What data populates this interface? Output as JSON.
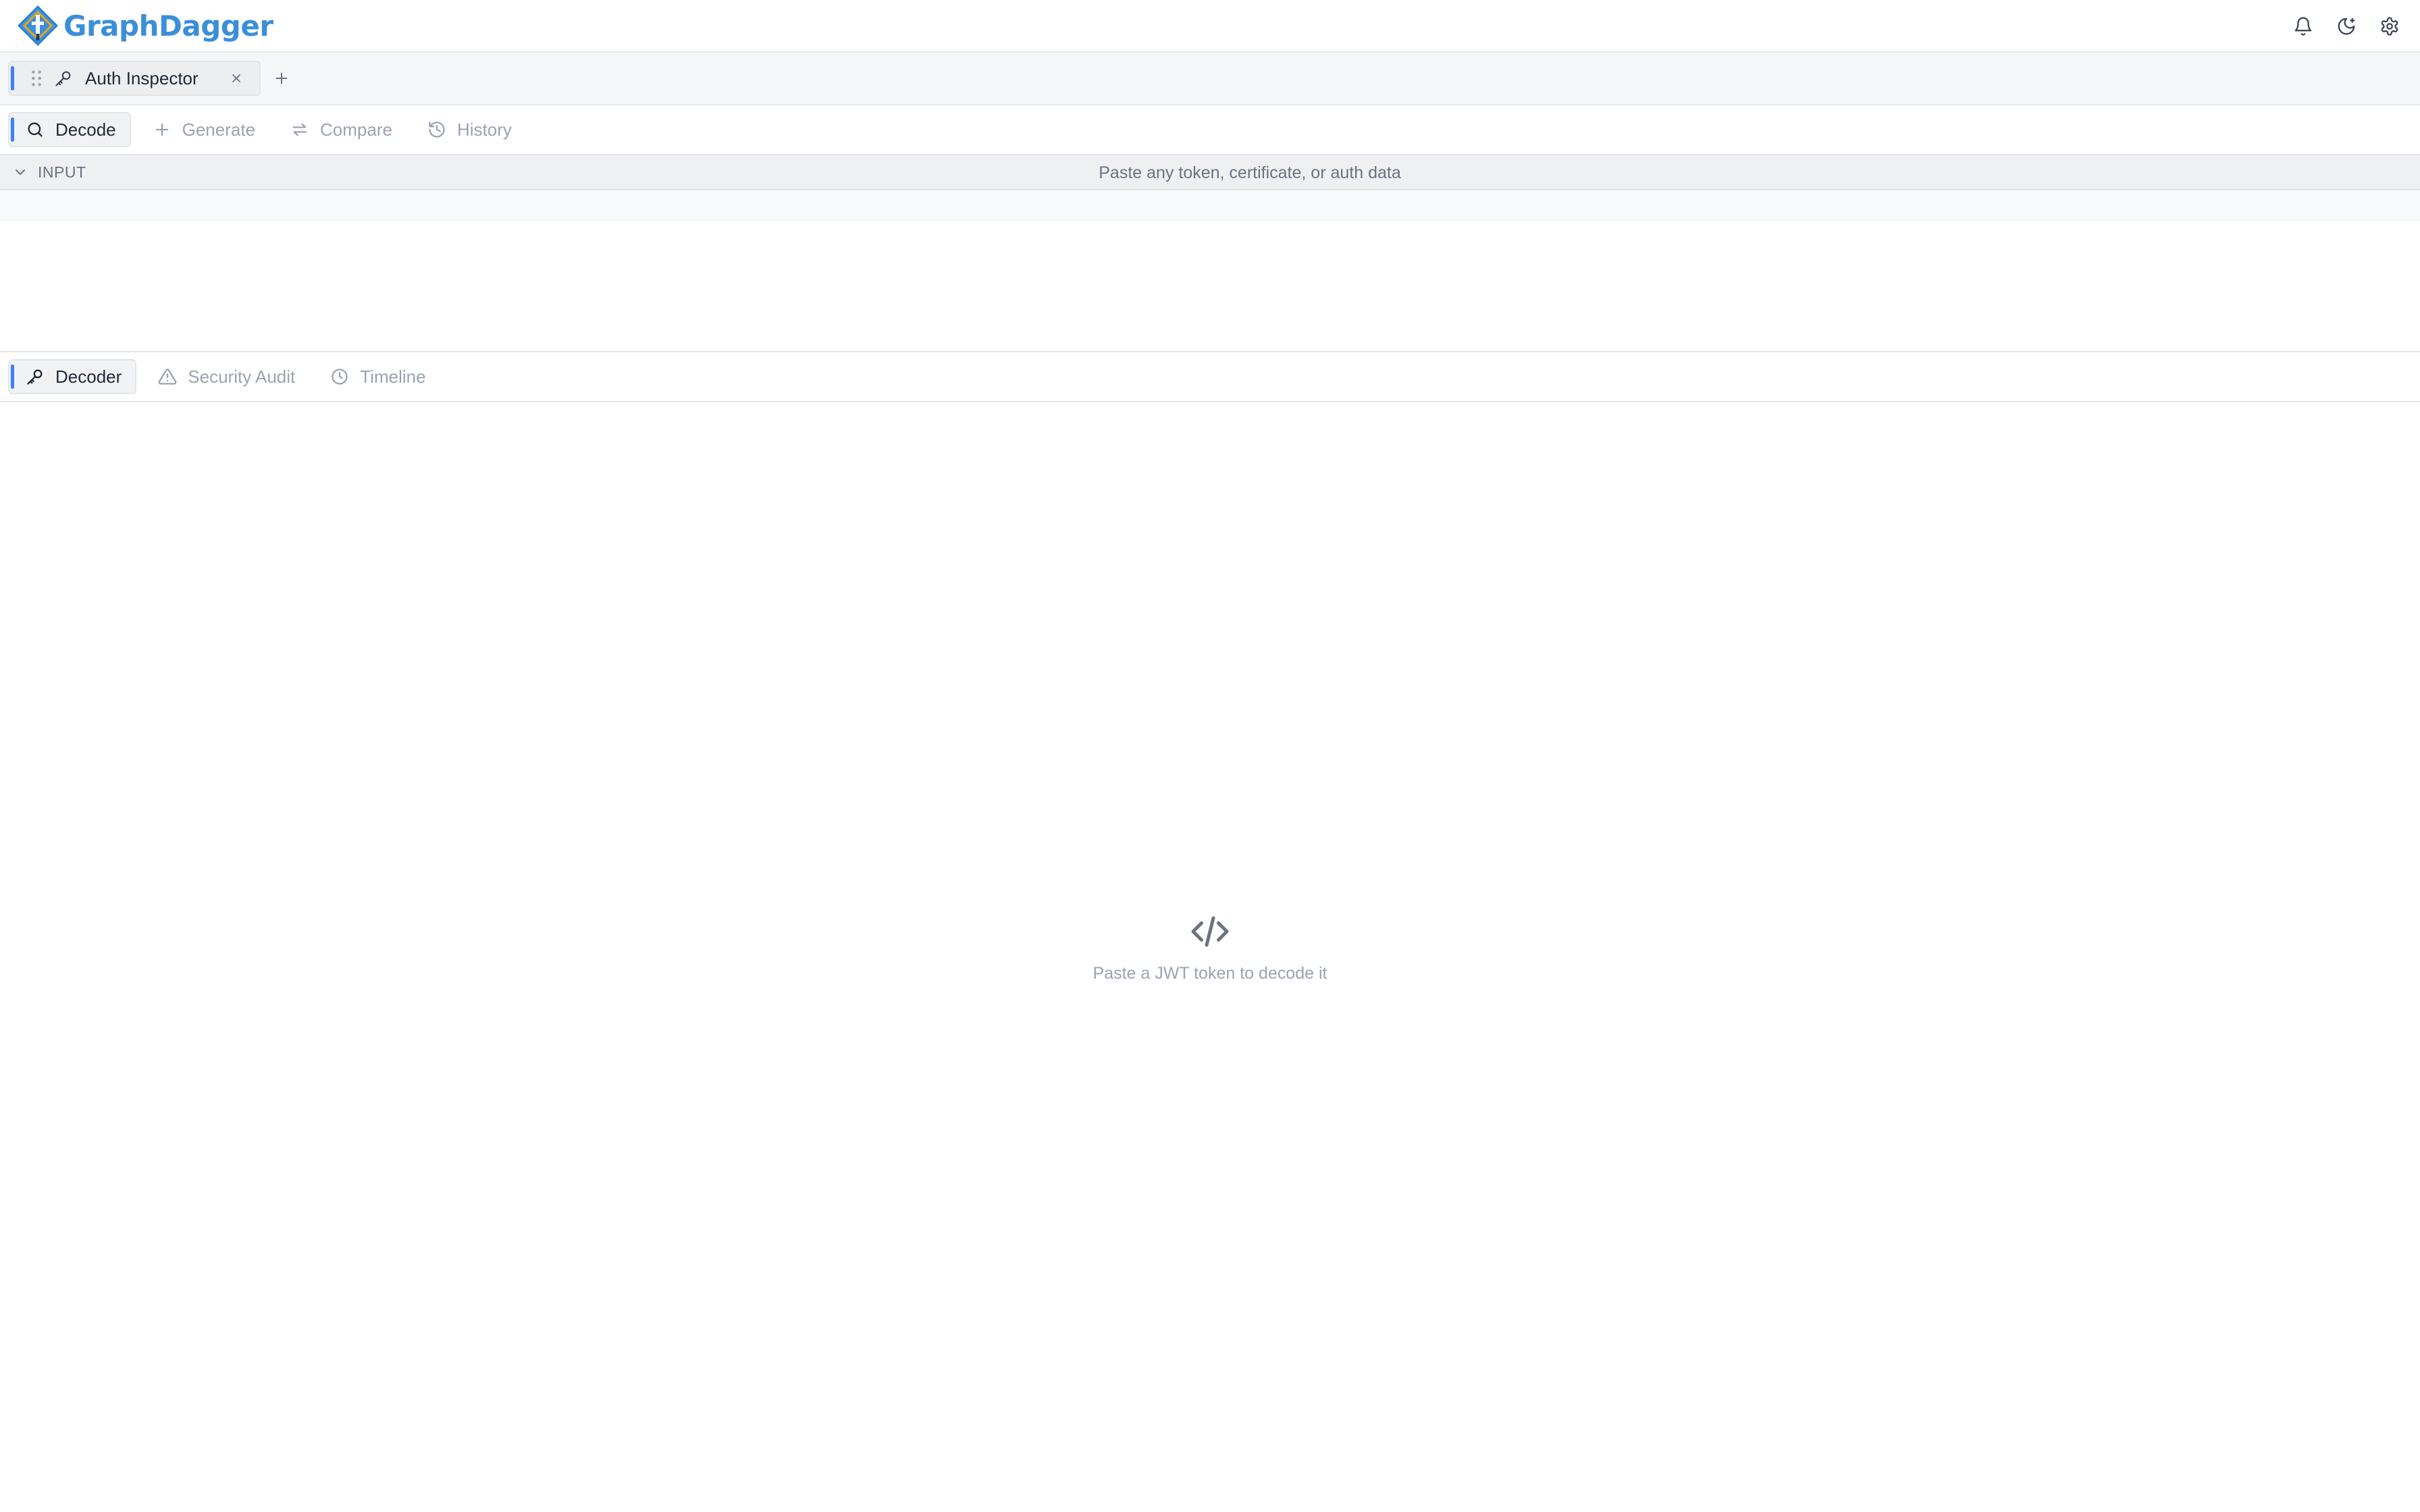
{
  "app": {
    "name": "GraphDagger",
    "brand_color": "#3b8fd9",
    "accent_color": "#3b82f6"
  },
  "header": {
    "actions": [
      {
        "icon": "bell-icon",
        "label": "Notifications"
      },
      {
        "icon": "moon-icon",
        "label": "Toggle theme"
      },
      {
        "icon": "gear-icon",
        "label": "Settings"
      }
    ]
  },
  "window_tabs": [
    {
      "label": "Auth Inspector",
      "icon": "key-icon",
      "active": true
    }
  ],
  "toolbar": {
    "tabs": [
      {
        "label": "Decode",
        "icon": "search-icon",
        "active": true
      },
      {
        "label": "Generate",
        "icon": "plus-icon",
        "active": false
      },
      {
        "label": "Compare",
        "icon": "swap-icon",
        "active": false
      },
      {
        "label": "History",
        "icon": "history-icon",
        "active": false
      }
    ]
  },
  "input": {
    "title": "INPUT",
    "hint": "Paste any token, certificate, or auth data",
    "value": ""
  },
  "results": {
    "tabs": [
      {
        "label": "Decoder",
        "icon": "key-icon",
        "active": true
      },
      {
        "label": "Security Audit",
        "icon": "warning-icon",
        "active": false
      },
      {
        "label": "Timeline",
        "icon": "clock-icon",
        "active": false
      }
    ]
  },
  "empty_state": {
    "icon": "code-icon",
    "message": "Paste a JWT token to decode it"
  }
}
